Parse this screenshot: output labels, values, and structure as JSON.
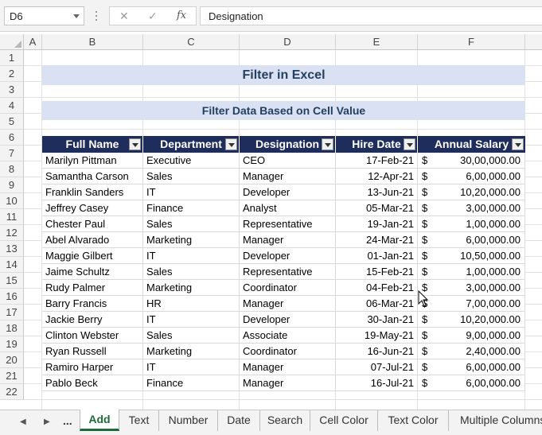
{
  "formula_bar": {
    "name_box": "D6",
    "formula": "Designation",
    "cancel_glyph": "✕",
    "enter_glyph": "✓",
    "fx_label": "fx"
  },
  "columns": [
    "A",
    "B",
    "C",
    "D",
    "E",
    "F"
  ],
  "rows": [
    "1",
    "2",
    "3",
    "4",
    "5",
    "6",
    "7",
    "8",
    "9",
    "10",
    "11",
    "12",
    "13",
    "14",
    "15",
    "16",
    "17",
    "18",
    "19",
    "20",
    "21",
    "22"
  ],
  "sheet": {
    "title": "Filter in Excel",
    "subtitle": "Filter Data Based on Cell Value"
  },
  "table": {
    "headers": [
      "Full Name",
      "Department",
      "Designation",
      "Hire Date",
      "Annual Salary"
    ],
    "currency_symbol": "$",
    "rows": [
      [
        "Marilyn Pittman",
        "Executive",
        "CEO",
        "17-Feb-21",
        "30,00,000.00"
      ],
      [
        "Samantha Carson",
        "Sales",
        "Manager",
        "12-Apr-21",
        "6,00,000.00"
      ],
      [
        "Franklin Sanders",
        "IT",
        "Developer",
        "13-Jun-21",
        "10,20,000.00"
      ],
      [
        "Jeffrey Casey",
        "Finance",
        "Analyst",
        "05-Mar-21",
        "3,00,000.00"
      ],
      [
        "Chester Paul",
        "Sales",
        "Representative",
        "19-Jan-21",
        "1,00,000.00"
      ],
      [
        "Abel Alvarado",
        "Marketing",
        "Manager",
        "24-Mar-21",
        "6,00,000.00"
      ],
      [
        "Maggie Gilbert",
        "IT",
        "Developer",
        "01-Jan-21",
        "10,50,000.00"
      ],
      [
        "Jaime Schultz",
        "Sales",
        "Representative",
        "15-Feb-21",
        "1,00,000.00"
      ],
      [
        "Rudy Palmer",
        "Marketing",
        "Coordinator",
        "04-Feb-21",
        "3,00,000.00"
      ],
      [
        "Barry Francis",
        "HR",
        "Manager",
        "06-Mar-21",
        "7,00,000.00"
      ],
      [
        "Jackie Berry",
        "IT",
        "Developer",
        "30-Jan-21",
        "10,20,000.00"
      ],
      [
        "Clinton Webster",
        "Sales",
        "Associate",
        "19-May-21",
        "9,00,000.00"
      ],
      [
        "Ryan Russell",
        "Marketing",
        "Coordinator",
        "16-Jun-21",
        "2,40,000.00"
      ],
      [
        "Ramiro Harper",
        "IT",
        "Manager",
        "07-Jul-21",
        "6,00,000.00"
      ],
      [
        "Pablo Beck",
        "Finance",
        "Manager",
        "16-Jul-21",
        "6,00,000.00"
      ]
    ]
  },
  "tabs": {
    "nav_prev": "◀",
    "nav_next": "▶",
    "nav_more": "...",
    "items": [
      "Add",
      "Text",
      "Number",
      "Date",
      "Search",
      "Cell Color",
      "Text Color",
      "Multiple Columns"
    ],
    "active": "Add"
  },
  "colors": {
    "header_fill": "#1f2d5c",
    "band_fill": "#d9e1f2",
    "title_text": "#243f60",
    "active_tab": "#1d6b3a"
  }
}
